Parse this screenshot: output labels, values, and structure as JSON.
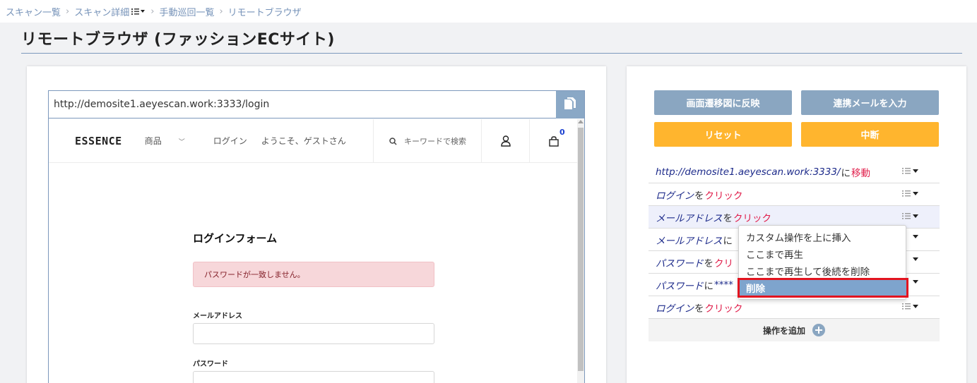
{
  "breadcrumb": {
    "items": [
      "スキャン一覧",
      "スキャン詳細",
      "手動巡回一覧"
    ],
    "current": "リモートブラウザ",
    "separator": ">"
  },
  "page": {
    "title": "リモートブラウザ (ファッションECサイト)"
  },
  "remote_browser": {
    "url": "http://demosite1.aeyescan.work:3333/login",
    "site": {
      "logo": "ESSENCE",
      "nav": {
        "products": "商品",
        "login": "ログイン",
        "welcome": "ようこそ、ゲストさん"
      },
      "search_placeholder": "キーワードで検索",
      "cart_count": "0",
      "form_title": "ログインフォーム",
      "alert": "パスワードが一致しません。",
      "email_label": "メールアドレス",
      "password_label": "パスワード"
    }
  },
  "controls": {
    "reflect_button": "画面遷移図に反映",
    "mail_button": "連携メールを入力",
    "reset_button": "リセット",
    "stop_button": "中断"
  },
  "operations": [
    {
      "target": "http://demosite1.aeyescan.work:3333/",
      "join": "に",
      "action": "移動"
    },
    {
      "target": "ログイン",
      "join": "を",
      "action": "クリック"
    },
    {
      "target": "メールアドレス",
      "join": "を",
      "action": "クリック"
    },
    {
      "target": "メールアドレス",
      "join": "に",
      "action": ""
    },
    {
      "target": "パスワード",
      "join": "を",
      "action": "クリ"
    },
    {
      "target": "パスワード",
      "join": "に",
      "action": "****"
    },
    {
      "target": "ログイン",
      "join": "を",
      "action": "クリック"
    }
  ],
  "add_operation_label": "操作を追加",
  "context_menu": {
    "items": [
      "カスタム操作を上に挿入",
      "ここまで再生",
      "ここまで再生して後続を削除",
      "削除"
    ],
    "active_index": 3
  },
  "colors": {
    "accent_blue": "#8aa6c1",
    "accent_orange": "#ffb52e",
    "action_red": "#e01d4a",
    "target_navy": "#1c2a8a",
    "highlight_red": "#e3141f"
  }
}
